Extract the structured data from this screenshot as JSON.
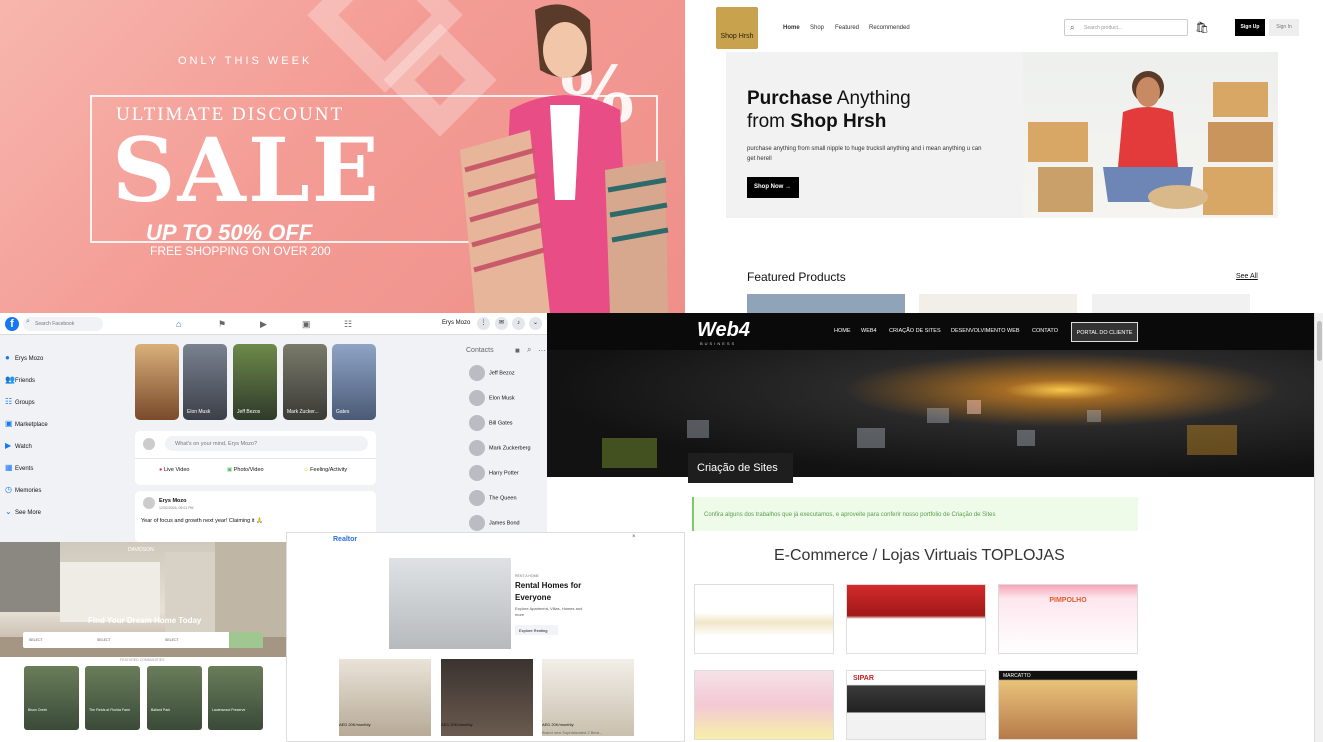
{
  "sale_banner": {
    "only": "ONLY THIS WEEK",
    "ultimate": "ULTIMATE DISCOUNT",
    "sale": "SALE",
    "upto": "UP TO 50% OFF",
    "free": "FREE SHOPPING ON OVER 200",
    "percent": "%"
  },
  "shop": {
    "logo_text": "Shop Hrsh",
    "nav": [
      "Home",
      "Shop",
      "Featured",
      "Recommended"
    ],
    "search_placeholder": "Search product...",
    "signup": "Sign Up",
    "signin": "Sign In",
    "hero_line1_light": "Purchase",
    "hero_line1_rest": " Anything",
    "hero_line2_light": "from ",
    "hero_line2_bold": "Shop Hrsh",
    "hero_desc": "purchase anything from small nipple to huge trucksll anything and i mean anything u can get herell",
    "shop_now": "Shop Now",
    "featured": "Featured Products",
    "see_all": "See All"
  },
  "facebook": {
    "search_placeholder": "Search Facebook",
    "user": "Erys Mozo",
    "sidebar": [
      "Erys Mozo",
      "Friends",
      "Groups",
      "Marketplace",
      "Watch",
      "Events",
      "Memories",
      "See More"
    ],
    "stories": [
      "",
      "Elon Musk",
      "Jeff Bezos",
      "Mark Zucker...",
      "Gates"
    ],
    "composer_placeholder": "What's on your mind, Erys Mozo?",
    "actions": [
      "Live Video",
      "Photo/Video",
      "Feeling/Activity"
    ],
    "post_author": "Erys Mozo",
    "post_date": "12/02/2024, 09:01 PM",
    "post_text": "Year of focus and growth next year! Claiming it 🙏",
    "contacts_label": "Contacts",
    "contacts": [
      "Jeff Bezoz",
      "Elon Musk",
      "Bill Gates",
      "Mark Zuckerberg",
      "Harry Potter",
      "The Queen",
      "James Bond"
    ]
  },
  "web4": {
    "logo": "Web4",
    "logo_sub": "BUSINESS",
    "nav": [
      "HOME",
      "WEB4",
      "CRIAÇÃO DE SITES",
      "DESENVOLVIMENTO WEB",
      "CONTATO"
    ],
    "portal": "PORTAL DO CLIENTE",
    "category": "Criação de Sites",
    "notice": "Confira alguns dos trabalhos que já executamos, e aproveite para conferir nosso portfolio de Criação de Sites",
    "ecommerce_title": "E-Commerce / Lojas Virtuais TOPLOJAS",
    "thumbs": [
      "",
      "",
      "PIMPOLHO",
      "",
      "SIPAR",
      "MARCATTO"
    ]
  },
  "davidson": {
    "logo": "DAVIDSON",
    "title": "Find Your Dream Home Today",
    "form_labels": [
      "SELECT",
      "SELECT",
      "SELECT"
    ],
    "section_label": "FEATURED COMMUNITIES",
    "cards": [
      "Bison Creek",
      "The Fields at Florida Farm",
      "Ballard Park",
      "Lauterwood Preserve"
    ]
  },
  "realtor": {
    "logo": "Realtor",
    "close": "×",
    "small": "RENT A HOME",
    "title": "Rental Homes for Everyone",
    "desc": "Explore Apartment, Villas, Homes and more",
    "button": "Explore Renting",
    "prices": [
      "AED 20K/monthly",
      "AED 20K/monthly",
      "AED 20K/monthly"
    ],
    "sub": "Brand new Sophisticated 2 Bedr..."
  },
  "colors": {
    "pink": "#f39c95",
    "facebook_blue": "#1877f2",
    "web4_green": "#5a9e4a",
    "realtor_blue": "#2b6fd8"
  }
}
